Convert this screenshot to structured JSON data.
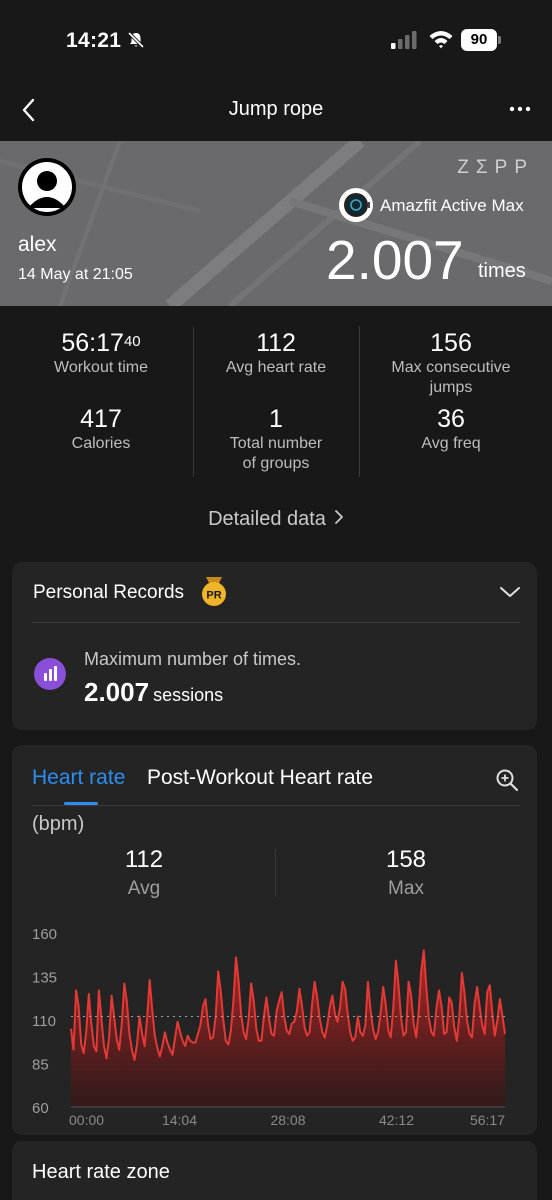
{
  "status_bar": {
    "time": "14:21",
    "battery": "90"
  },
  "nav": {
    "title": "Jump rope"
  },
  "hero": {
    "user_name": "alex",
    "date": "14 May at 21:05",
    "brand": "ZΣPP",
    "device": "Amazfit Active Max",
    "total_value": "2.007",
    "total_unit": "times"
  },
  "stats": [
    {
      "value": "56:17",
      "value_sup": "40",
      "label": "Workout time"
    },
    {
      "value": "112",
      "label": "Avg heart rate"
    },
    {
      "value": "156",
      "label_line1": "Max consecutive",
      "label_line2": "jumps"
    },
    {
      "value": "417",
      "label": "Calories"
    },
    {
      "value": "1",
      "label_line1": "Total number",
      "label_line2": "of groups"
    },
    {
      "value": "36",
      "label": "Avg freq"
    }
  ],
  "detailed_link": "Detailed data",
  "personal_records": {
    "title": "Personal Records",
    "badge": "PR",
    "record_label": "Maximum number of times.",
    "record_value": "2.007",
    "record_unit": "sessions"
  },
  "heart_rate": {
    "tab_active": "Heart rate",
    "tab_other": "Post-Workout Heart rate",
    "unit": "(bpm)",
    "avg_value": "112",
    "avg_label": "Avg",
    "max_value": "158",
    "max_label": "Max"
  },
  "chart_data": {
    "type": "area",
    "ylabel": "(bpm)",
    "ylim": [
      60,
      160
    ],
    "y_ticks": [
      "160",
      "135",
      "110",
      "85",
      "60"
    ],
    "x_ticks": [
      "00:00",
      "14:04",
      "28:08",
      "42:12",
      "56:17"
    ],
    "avg_line": 112,
    "grid": false,
    "color": "#e53935",
    "series": [
      {
        "values": [
          105,
          93,
          127,
          118,
          96,
          91,
          103,
          125,
          108,
          95,
          92,
          127,
          110,
          95,
          88,
          100,
          124,
          112,
          99,
          93,
          108,
          131,
          121,
          102,
          93,
          87,
          96,
          112,
          102,
          95,
          111,
          133,
          116,
          101,
          94,
          89,
          95,
          103,
          97,
          93,
          90,
          100,
          109,
          103,
          98,
          95,
          101,
          98,
          97,
          97,
          102,
          107,
          118,
          122,
          107,
          99,
          100,
          112,
          138,
          127,
          110,
          98,
          96,
          104,
          121,
          146,
          133,
          114,
          103,
          99,
          111,
          131,
          121,
          105,
          98,
          98,
          112,
          123,
          111,
          102,
          101,
          115,
          121,
          126,
          112,
          104,
          102,
          108,
          109,
          115,
          128,
          118,
          106,
          101,
          103,
          119,
          132,
          123,
          111,
          103,
          100,
          107,
          118,
          124,
          113,
          109,
          117,
          132,
          128,
          114,
          103,
          98,
          100,
          112,
          103,
          101,
          107,
          132,
          116,
          105,
          99,
          103,
          114,
          129,
          119,
          104,
          100,
          117,
          144,
          131,
          112,
          101,
          103,
          132,
          124,
          108,
          100,
          115,
          138,
          150,
          129,
          111,
          103,
          101,
          117,
          127,
          118,
          102,
          103,
          123,
          120,
          106,
          98,
          112,
          137,
          126,
          110,
          102,
          100,
          119,
          129,
          118,
          107,
          102,
          126,
          130,
          114,
          101,
          110,
          122,
          112,
          102
        ]
      }
    ]
  },
  "heart_rate_zone": {
    "title": "Heart rate zone"
  }
}
